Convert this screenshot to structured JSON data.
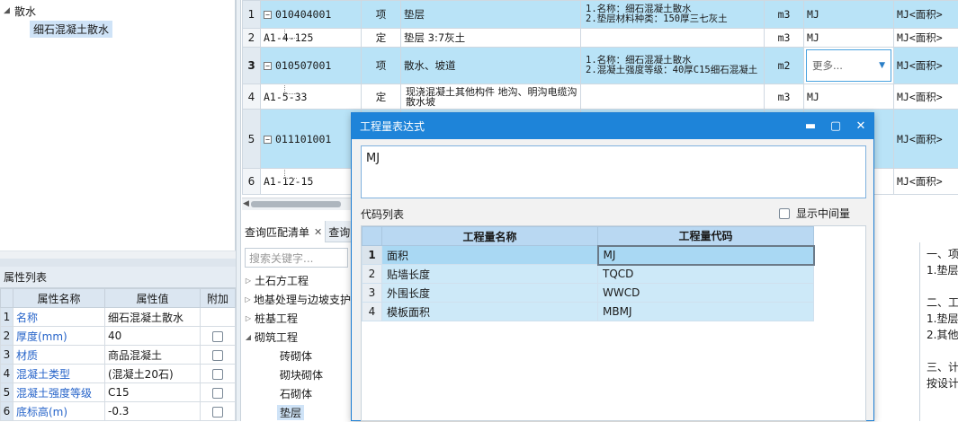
{
  "tree": {
    "root_label": "散水",
    "child_label": "细石混凝土散水"
  },
  "props": {
    "title": "属性列表",
    "columns": [
      "属性名称",
      "属性值",
      "附加"
    ],
    "rows": [
      {
        "num": "1",
        "name": "名称",
        "value": "细石混凝土散水",
        "has_check": false
      },
      {
        "num": "2",
        "name": "厚度(mm)",
        "value": "40",
        "has_check": true
      },
      {
        "num": "3",
        "name": "材质",
        "value": "商品混凝土",
        "has_check": true
      },
      {
        "num": "4",
        "name": "混凝土类型",
        "value": "(混凝土20石)",
        "has_check": true
      },
      {
        "num": "5",
        "name": "混凝土强度等级",
        "value": "C15",
        "has_check": true
      },
      {
        "num": "6",
        "name": "底标高(m)",
        "value": "-0.3",
        "has_check": true
      }
    ]
  },
  "grid": {
    "rows": [
      {
        "num": "1",
        "code": "010404001",
        "type": "项",
        "name": "垫层",
        "desc_line1": "1.名称：细石混凝土散水",
        "desc_line2": "2.垫层材料种类：150厚三七灰土",
        "unit": "m3",
        "expr": "MJ",
        "expr2": "MJ<面积>"
      },
      {
        "num": "2",
        "code": "A1-4-125",
        "type": "定",
        "name": "垫层 3:7灰土",
        "desc_line1": "",
        "desc_line2": "",
        "unit": "m3",
        "expr": "MJ",
        "expr2": "MJ<面积>"
      },
      {
        "num": "3",
        "code": "010507001",
        "type": "项",
        "name": "散水、坡道",
        "desc_line1": "1.名称：细石混凝土散水",
        "desc_line2": "2.混凝土强度等级：40厚C15细石混凝土",
        "unit": "m2",
        "expr": "更多...",
        "expr2": "MJ<面积>"
      },
      {
        "num": "4",
        "code": "A1-5-33",
        "type": "定",
        "name": "现浇混凝土其他构件 地沟、明沟电缆沟散水坡",
        "desc_line1": "",
        "desc_line2": "",
        "unit": "m3",
        "expr": "MJ",
        "expr2": "MJ<面积>"
      },
      {
        "num": "5",
        "code": "011101001",
        "type": "",
        "name": "",
        "desc_line1": "",
        "desc_line2": "",
        "unit": "",
        "expr": "",
        "expr2": "MJ<面积>"
      },
      {
        "num": "6",
        "code": "A1-12-15",
        "type": "",
        "name": "",
        "desc_line1": "",
        "desc_line2": "",
        "unit": "",
        "expr": "",
        "expr2": "MJ<面积>"
      }
    ]
  },
  "bottom": {
    "tab_query": "查询匹配清单",
    "tab_query_close": "✕",
    "tab_more": "查询",
    "search_placeholder": "搜索关键字...",
    "tree_items": [
      {
        "label": "土石方工程",
        "expanded": false
      },
      {
        "label": "地基处理与边坡支护",
        "expanded": false
      },
      {
        "label": "桩基工程",
        "expanded": false
      },
      {
        "label": "砌筑工程",
        "expanded": true
      }
    ],
    "sub_items": [
      "砖砌体",
      "砌块砌体",
      "石砌体",
      "垫层"
    ],
    "right_lines": [
      "一、项",
      "1.垫层",
      "",
      "二、工",
      "1.垫层",
      "2.其他",
      "",
      "三、计",
      "按设计"
    ]
  },
  "dialog": {
    "title": "工程量表达式",
    "expression": "MJ",
    "code_list_label": "代码列表",
    "show_mid_label": "显示中间量",
    "columns": [
      "工程量名称",
      "工程量代码"
    ],
    "rows": [
      {
        "num": "1",
        "name": "面积",
        "code": "MJ"
      },
      {
        "num": "2",
        "name": "贴墙长度",
        "code": "TQCD"
      },
      {
        "num": "3",
        "name": "外围长度",
        "code": "WWCD"
      },
      {
        "num": "4",
        "name": "模板面积",
        "code": "MBMJ"
      }
    ]
  },
  "colors": {
    "highlight_row": "#b9e3f7",
    "dialog_title": "#1e84d9",
    "link_blue": "#2563c9"
  }
}
